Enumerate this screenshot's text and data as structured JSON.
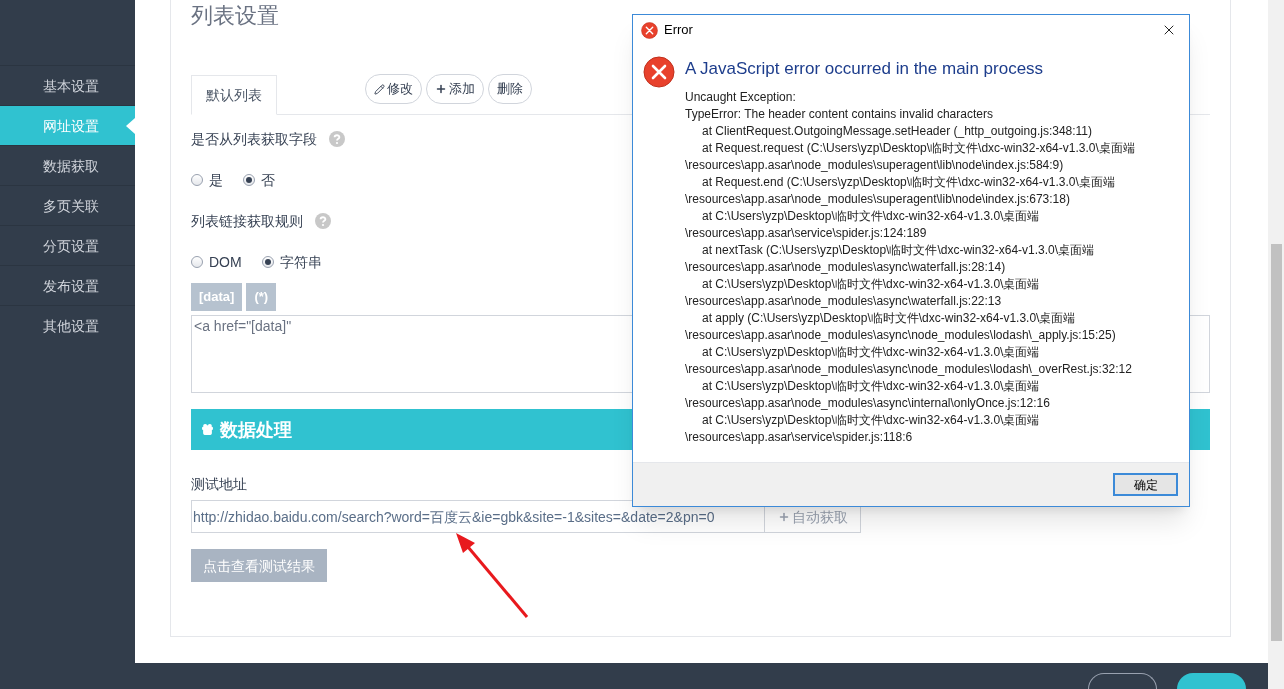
{
  "sidebar": {
    "items": [
      {
        "label": "基本设置",
        "selected": false
      },
      {
        "label": "网址设置",
        "selected": true
      },
      {
        "label": "数据获取",
        "selected": false
      },
      {
        "label": "多页关联",
        "selected": false
      },
      {
        "label": "分页设置",
        "selected": false
      },
      {
        "label": "发布设置",
        "selected": false
      },
      {
        "label": "其他设置",
        "selected": false
      }
    ]
  },
  "title": "列表设置",
  "tabs": [
    {
      "label": "默认列表",
      "selected": true
    }
  ],
  "tab_actions": [
    {
      "label": "修改",
      "kind": "edit"
    },
    {
      "label": "添加",
      "kind": "add"
    },
    {
      "label": "删除",
      "kind": "plain"
    }
  ],
  "field_source": {
    "label": "是否从列表获取字段",
    "options": [
      {
        "label": "是",
        "selected": false
      },
      {
        "label": "否",
        "selected": true
      }
    ]
  },
  "link_rule": {
    "label": "列表链接获取规则",
    "options": [
      {
        "label": "DOM",
        "selected": false
      },
      {
        "label": "字符串",
        "selected": true
      }
    ],
    "tokens": [
      "[data]",
      "(*)"
    ],
    "value": "<a href=\"[data]\""
  },
  "section": {
    "title": "数据处理"
  },
  "test": {
    "label": "测试地址",
    "value": "http://zhidao.baidu.com/search?word=百度云&ie=gbk&site=-1&sites=&date=2&pn=0",
    "fetch_button": "自动获取",
    "result_button": "点击查看测试结果"
  },
  "dialog": {
    "title": "Error",
    "heading": "A JavaScript error occurred in the main process",
    "lines": [
      {
        "text": "Uncaught Exception:",
        "kind": "message"
      },
      {
        "text": "TypeError: The header content contains invalid characters",
        "kind": "message"
      },
      {
        "text": "at ClientRequest.OutgoingMessage.setHeader (_http_outgoing.js:348:11)",
        "kind": "frame"
      },
      {
        "text": "at Request.request (C:\\Users\\yzp\\Desktop\\临时文件\\dxc-win32-x64-v1.3.0\\桌面端",
        "kind": "frame"
      },
      {
        "text": "\\resources\\app.asar\\node_modules\\superagent\\lib\\node\\index.js:584:9)",
        "kind": "message"
      },
      {
        "text": "at Request.end (C:\\Users\\yzp\\Desktop\\临时文件\\dxc-win32-x64-v1.3.0\\桌面端",
        "kind": "frame"
      },
      {
        "text": "\\resources\\app.asar\\node_modules\\superagent\\lib\\node\\index.js:673:18)",
        "kind": "message"
      },
      {
        "text": "at C:\\Users\\yzp\\Desktop\\临时文件\\dxc-win32-x64-v1.3.0\\桌面端",
        "kind": "frame"
      },
      {
        "text": "\\resources\\app.asar\\service\\spider.js:124:189",
        "kind": "message"
      },
      {
        "text": "at nextTask (C:\\Users\\yzp\\Desktop\\临时文件\\dxc-win32-x64-v1.3.0\\桌面端",
        "kind": "frame"
      },
      {
        "text": "\\resources\\app.asar\\node_modules\\async\\waterfall.js:28:14)",
        "kind": "message"
      },
      {
        "text": "at C:\\Users\\yzp\\Desktop\\临时文件\\dxc-win32-x64-v1.3.0\\桌面端",
        "kind": "frame"
      },
      {
        "text": "\\resources\\app.asar\\node_modules\\async\\waterfall.js:22:13",
        "kind": "message"
      },
      {
        "text": "at apply (C:\\Users\\yzp\\Desktop\\临时文件\\dxc-win32-x64-v1.3.0\\桌面端",
        "kind": "frame"
      },
      {
        "text": "\\resources\\app.asar\\node_modules\\async\\node_modules\\lodash\\_apply.js:15:25)",
        "kind": "message"
      },
      {
        "text": "at C:\\Users\\yzp\\Desktop\\临时文件\\dxc-win32-x64-v1.3.0\\桌面端",
        "kind": "frame"
      },
      {
        "text": "\\resources\\app.asar\\node_modules\\async\\node_modules\\lodash\\_overRest.js:32:12",
        "kind": "message"
      },
      {
        "text": "at C:\\Users\\yzp\\Desktop\\临时文件\\dxc-win32-x64-v1.3.0\\桌面端",
        "kind": "frame"
      },
      {
        "text": "\\resources\\app.asar\\node_modules\\async\\internal\\onlyOnce.js:12:16",
        "kind": "message"
      },
      {
        "text": "at C:\\Users\\yzp\\Desktop\\临时文件\\dxc-win32-x64-v1.3.0\\桌面端",
        "kind": "frame"
      },
      {
        "text": "\\resources\\app.asar\\service\\spider.js:118:6",
        "kind": "message"
      }
    ],
    "ok_button": "确定"
  }
}
